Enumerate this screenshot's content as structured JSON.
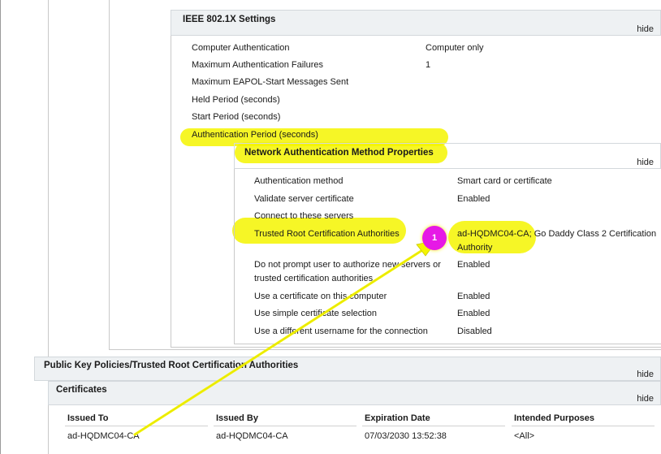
{
  "ieee": {
    "title": "IEEE 802.1X Settings",
    "hide": "hide",
    "rows": [
      {
        "label": "Computer Authentication",
        "value": "Computer only"
      },
      {
        "label": "Maximum Authentication Failures",
        "value": "1"
      },
      {
        "label": "Maximum EAPOL-Start Messages Sent",
        "value": ""
      },
      {
        "label": "Held Period (seconds)",
        "value": ""
      },
      {
        "label": "Start Period (seconds)",
        "value": ""
      },
      {
        "label": "Authentication Period (seconds)",
        "value": ""
      }
    ]
  },
  "nam": {
    "title": "Network Authentication Method Properties",
    "hide": "hide",
    "rows": [
      {
        "label": "Authentication method",
        "value": "Smart card or certificate"
      },
      {
        "label": "Validate server certificate",
        "value": "Enabled"
      },
      {
        "label": "Connect to these servers",
        "value": ""
      },
      {
        "label": "Trusted Root Certification Authorities",
        "value_line1": "ad-HQDMC04-CA; Go Daddy Class 2 Certification",
        "value_line2": "Authority"
      },
      {
        "label_line1": "Do not prompt user to authorize new servers or",
        "label_line2": "trusted certification authorities",
        "value": "Enabled"
      },
      {
        "label": "Use a certificate on this computer",
        "value": "Enabled"
      },
      {
        "label": "Use simple certificate selection",
        "value": "Enabled"
      },
      {
        "label": "Use a different username for the connection",
        "value": "Disabled"
      }
    ]
  },
  "pkp": {
    "title": "Public Key Policies/Trusted Root Certification Authorities",
    "hide": "hide"
  },
  "certs": {
    "title": "Certificates",
    "hide": "hide",
    "columns": [
      "Issued To",
      "Issued By",
      "Expiration Date",
      "Intended Purposes"
    ],
    "rows": [
      [
        "ad-HQDMC04-CA",
        "ad-HQDMC04-CA",
        "07/03/2030 13:52:38",
        "<All>"
      ]
    ]
  },
  "annotation": {
    "badge": "1",
    "highlight_color": "#f4f400",
    "badge_color": "#e619e6"
  }
}
